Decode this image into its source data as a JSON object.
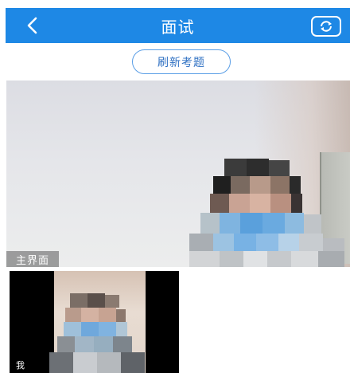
{
  "header": {
    "title": "面试",
    "back_icon": "chevron-left-icon",
    "camera_icon": "camera-switch-icon",
    "background": "#1e88e5"
  },
  "toolbar": {
    "refresh_label": "刷新考题"
  },
  "videos": {
    "main_label": "主界面",
    "self_label": "我"
  }
}
